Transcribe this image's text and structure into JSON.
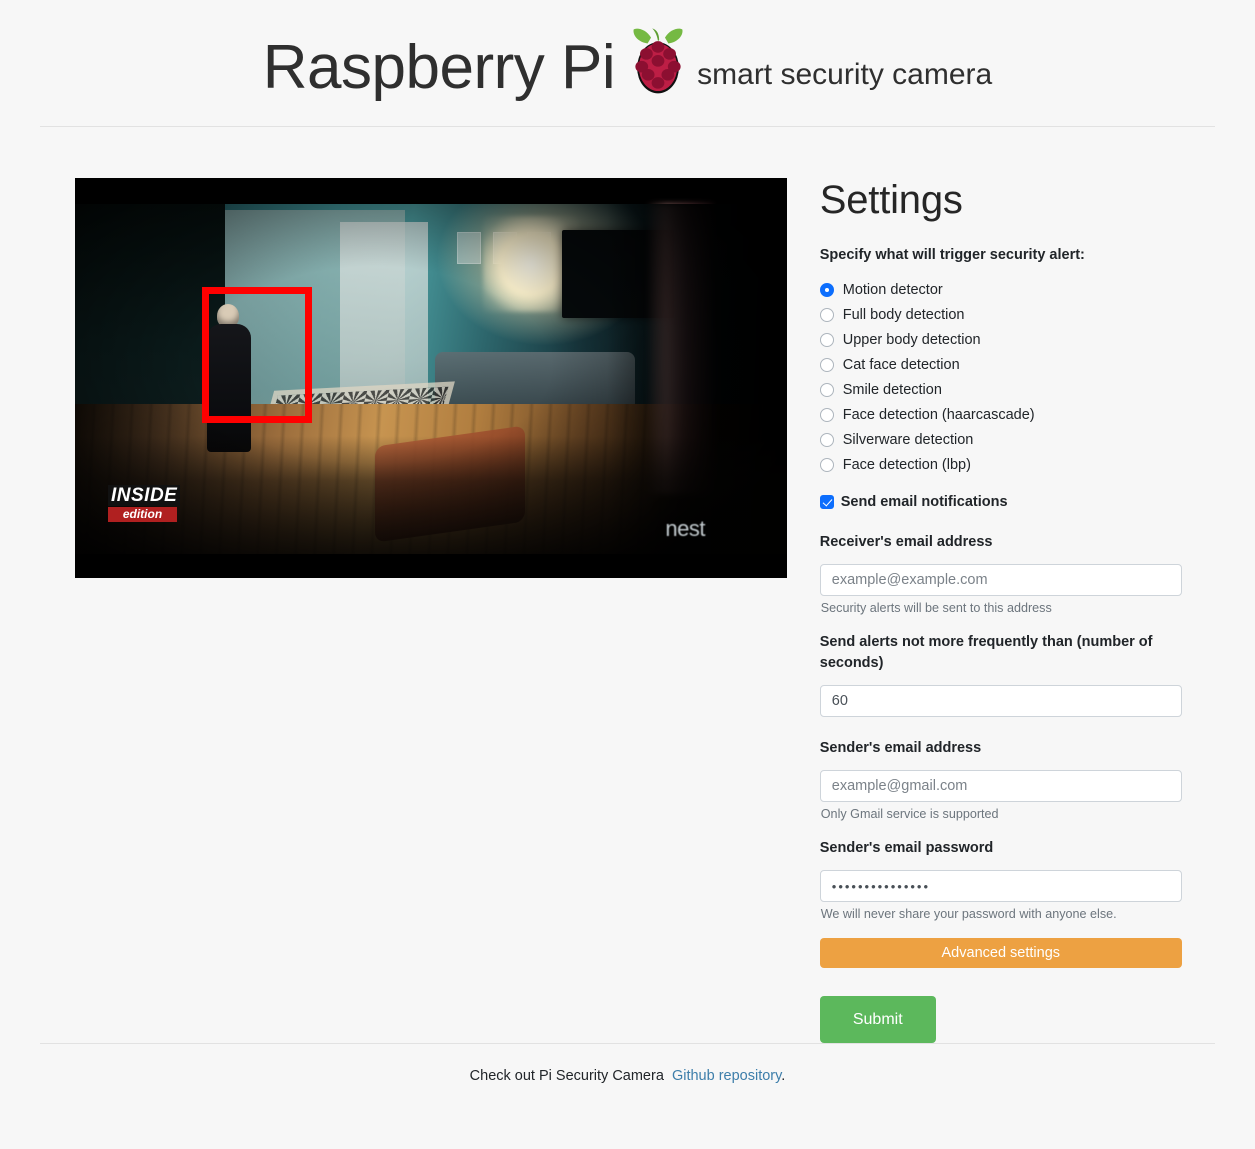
{
  "header": {
    "brand_title": "Raspberry Pi",
    "brand_subtitle": "smart security camera",
    "logo_name": "raspberry-pi-logo"
  },
  "video_feed": {
    "alt": "Live security camera feed",
    "detection_box_color": "#ff0000",
    "watermark_broadcaster_line1": "INSIDE",
    "watermark_broadcaster_line2": "edition",
    "watermark_device": "nest"
  },
  "settings": {
    "title": "Settings",
    "trigger_label": "Specify what will trigger security alert:",
    "trigger_options": [
      {
        "label": "Motion detector",
        "selected": true
      },
      {
        "label": "Full body detection",
        "selected": false
      },
      {
        "label": "Upper body detection",
        "selected": false
      },
      {
        "label": "Cat face detection",
        "selected": false
      },
      {
        "label": "Smile detection",
        "selected": false
      },
      {
        "label": "Face detection (haarcascade)",
        "selected": false
      },
      {
        "label": "Silverware detection",
        "selected": false
      },
      {
        "label": "Face detection (lbp)",
        "selected": false
      }
    ],
    "email_notifications": {
      "label": "Send email notifications",
      "checked": true
    },
    "receiver_email": {
      "label": "Receiver's email address",
      "placeholder": "example@example.com",
      "value": "",
      "help": "Security alerts will be sent to this address"
    },
    "alert_interval": {
      "label": "Send alerts not more frequently than (number of seconds)",
      "placeholder": "60",
      "value": "60"
    },
    "sender_email": {
      "label": "Sender's email address",
      "placeholder": "example@gmail.com",
      "value": "",
      "help": "Only Gmail service is supported"
    },
    "sender_password": {
      "label": "Sender's email password",
      "value": "•••••••••••••••",
      "help": "We will never share your password with anyone else."
    },
    "advanced_button": "Advanced settings",
    "submit_button": "Submit",
    "accent_colors": {
      "radio_checked": "#0d6efd",
      "advanced": "#eda142",
      "submit": "#5cb85c",
      "link": "#3d7eaa"
    }
  },
  "footer": {
    "text": "Check out Pi Security Camera",
    "link_text": "Github repository",
    "trailing": "."
  }
}
